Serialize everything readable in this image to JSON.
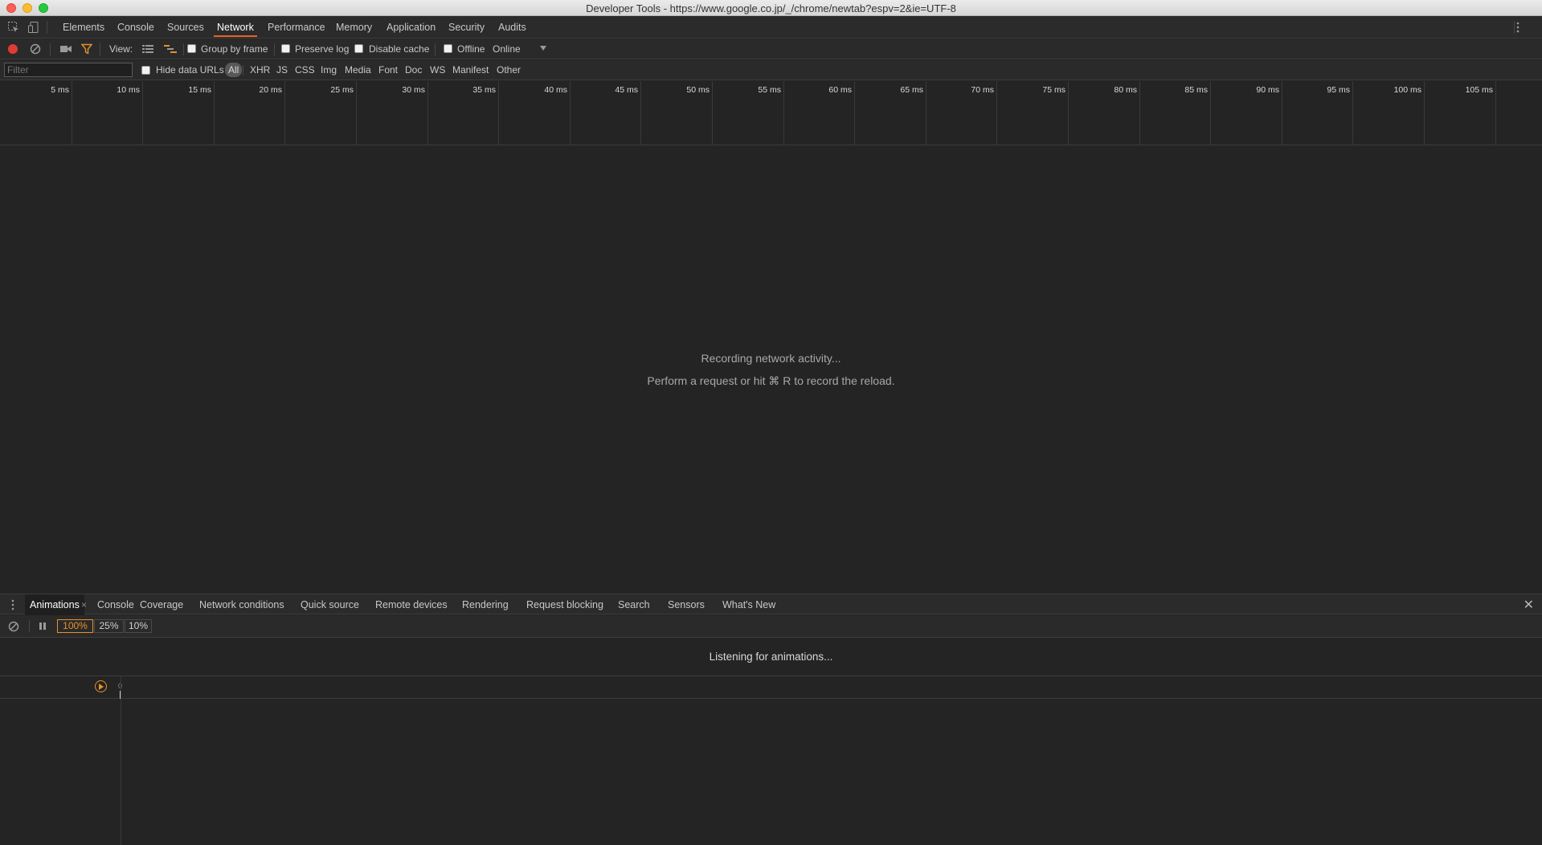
{
  "window": {
    "title": "Developer Tools - https://www.google.co.jp/_/chrome/newtab?espv=2&ie=UTF-8"
  },
  "main_tabs": [
    {
      "label": "Elements",
      "active": false
    },
    {
      "label": "Console",
      "active": false
    },
    {
      "label": "Sources",
      "active": false
    },
    {
      "label": "Network",
      "active": true
    },
    {
      "label": "Performance",
      "active": false
    },
    {
      "label": "Memory",
      "active": false
    },
    {
      "label": "Application",
      "active": false
    },
    {
      "label": "Security",
      "active": false
    },
    {
      "label": "Audits",
      "active": false
    }
  ],
  "toolbar": {
    "view_label": "View:",
    "group_by_frame": "Group by frame",
    "preserve_log": "Preserve log",
    "disable_cache": "Disable cache",
    "offline": "Offline",
    "throttle": "Online"
  },
  "filter": {
    "placeholder": "Filter",
    "hide_data_urls": "Hide data URLs",
    "types": [
      "All",
      "XHR",
      "JS",
      "CSS",
      "Img",
      "Media",
      "Font",
      "Doc",
      "WS",
      "Manifest",
      "Other"
    ],
    "selected": "All"
  },
  "timeline": {
    "ticks": [
      "5 ms",
      "10 ms",
      "15 ms",
      "20 ms",
      "25 ms",
      "30 ms",
      "35 ms",
      "40 ms",
      "45 ms",
      "50 ms",
      "55 ms",
      "60 ms",
      "65 ms",
      "70 ms",
      "75 ms",
      "80 ms",
      "85 ms",
      "90 ms",
      "95 ms",
      "100 ms",
      "105 ms"
    ],
    "tick_values_ms": [
      5,
      10,
      15,
      20,
      25,
      30,
      35,
      40,
      45,
      50,
      55,
      60,
      65,
      70,
      75,
      80,
      85,
      90,
      95,
      100,
      105
    ]
  },
  "empty_state": {
    "line1": "Recording network activity...",
    "line2": "Perform a request or hit ⌘ R to record the reload."
  },
  "drawer": {
    "tabs": [
      "Animations",
      "Console",
      "Coverage",
      "Network conditions",
      "Quick source",
      "Remote devices",
      "Rendering",
      "Request blocking",
      "Search",
      "Sensors",
      "What's New"
    ],
    "active": "Animations",
    "tab_close": "×",
    "close": "✕"
  },
  "animations": {
    "speeds": [
      "100%",
      "25%",
      "10%"
    ],
    "selected_speed": "100%",
    "listening": "Listening for animations...",
    "zero_label": "0"
  },
  "colors": {
    "accent": "#e8632b",
    "record": "#e23b34",
    "highlight": "#e02020",
    "anim_accent": "#e8922b"
  }
}
